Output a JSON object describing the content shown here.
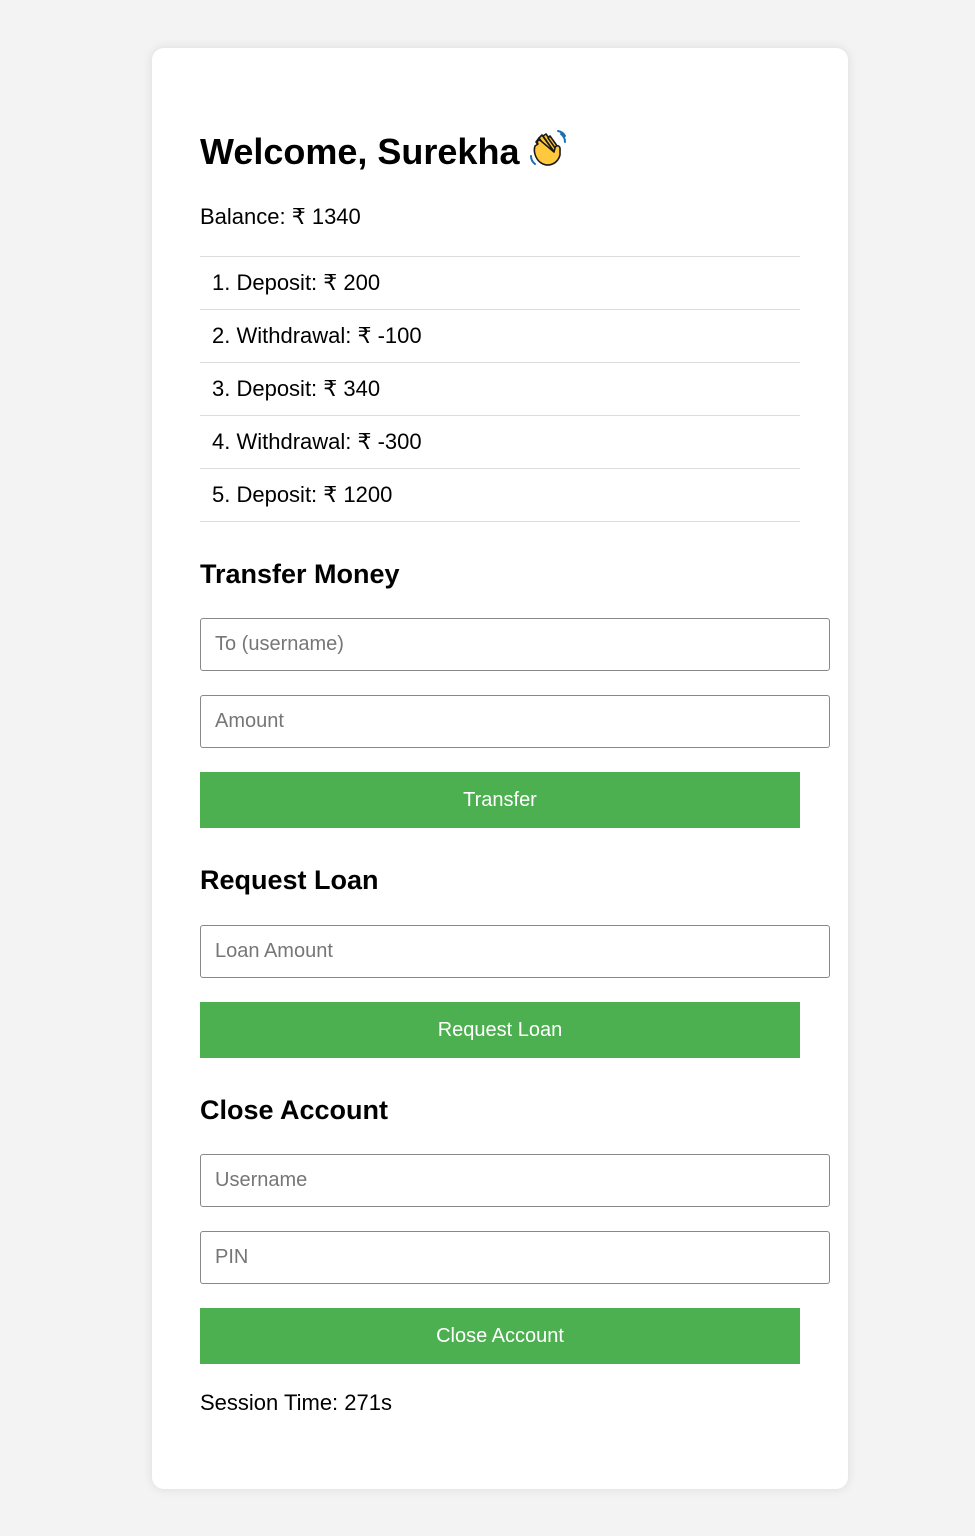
{
  "header": {
    "welcome": "Welcome, Surekha",
    "wave_icon": "waving-hand-icon"
  },
  "balance": {
    "text": "Balance: ₹ 1340"
  },
  "transactions": [
    {
      "text": "1. Deposit: ₹ 200"
    },
    {
      "text": "2. Withdrawal: ₹ -100"
    },
    {
      "text": "3. Deposit: ₹ 340"
    },
    {
      "text": "4. Withdrawal: ₹ -300"
    },
    {
      "text": "5. Deposit: ₹ 1200"
    }
  ],
  "transfer": {
    "title": "Transfer Money",
    "to_placeholder": "To (username)",
    "amount_placeholder": "Amount",
    "button_label": "Transfer"
  },
  "loan": {
    "title": "Request Loan",
    "amount_placeholder": "Loan Amount",
    "button_label": "Request Loan"
  },
  "close_account": {
    "title": "Close Account",
    "username_placeholder": "Username",
    "pin_placeholder": "PIN",
    "button_label": "Close Account"
  },
  "session": {
    "text": "Session Time: 271s"
  },
  "colors": {
    "page_background": "#f3f3f3",
    "card_background": "#ffffff",
    "button_green": "#4caf50",
    "button_text": "#ffffff",
    "divider": "#dddddd"
  }
}
